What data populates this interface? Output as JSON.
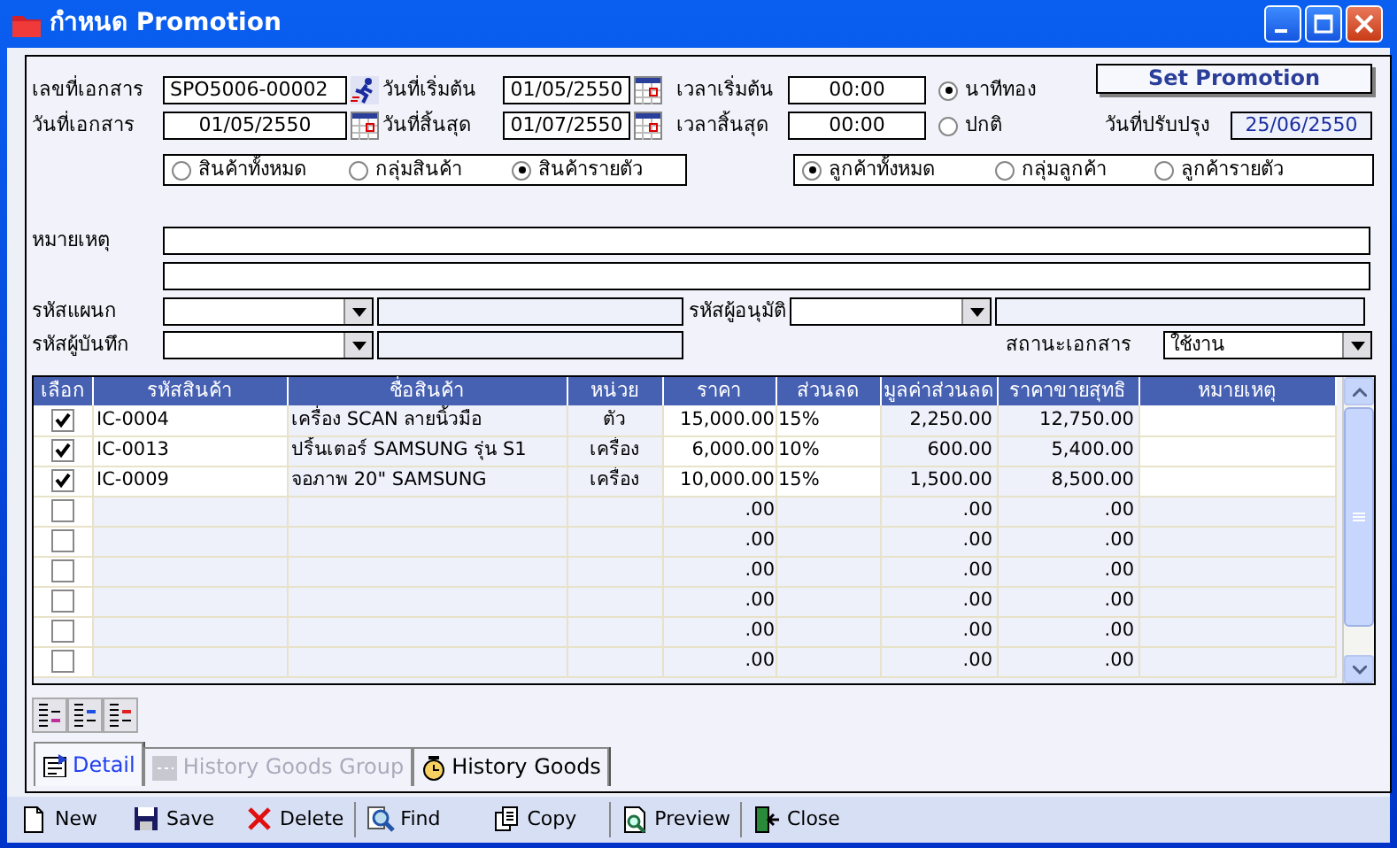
{
  "window": {
    "title": "กำหนด Promotion"
  },
  "header": {
    "document_no": {
      "label": "เลขที่เอกสาร",
      "value": "SPO5006-00002"
    },
    "start_date": {
      "label": "วันที่เริ่มต้น",
      "value": "01/05/2550"
    },
    "start_time": {
      "label": "เวลาเริ่มต้น",
      "value": "00:00"
    },
    "document_date": {
      "label": "วันที่เอกสาร",
      "value": "01/05/2550"
    },
    "end_date": {
      "label": "วันที่สิ้นสุด",
      "value": "01/07/2550"
    },
    "end_time": {
      "label": "เวลาสิ้นสุด",
      "value": "00:00"
    },
    "promotion_type": [
      {
        "label": "นาทีทอง",
        "selected": true
      },
      {
        "label": "ปกติ",
        "selected": false
      }
    ],
    "set_promotion_button": "Set Promotion",
    "updated_date": {
      "label": "วันที่ปรับปรุง",
      "value": "25/06/2550"
    },
    "product_scope": [
      {
        "label": "สินค้าทั้งหมด",
        "selected": false
      },
      {
        "label": "กลุ่มสินค้า",
        "selected": false
      },
      {
        "label": "สินค้ารายตัว",
        "selected": true
      }
    ],
    "customer_scope": [
      {
        "label": "ลูกค้าทั้งหมด",
        "selected": true
      },
      {
        "label": "กลุ่มลูกค้า",
        "selected": false
      },
      {
        "label": "ลูกค้ารายตัว",
        "selected": false
      }
    ],
    "remark": {
      "label": "หมายเหตุ"
    },
    "department": {
      "label": "รหัสแผนก"
    },
    "approver": {
      "label": "รหัสผู้อนุมัติ"
    },
    "recorder": {
      "label": "รหัสผู้บันทึก"
    },
    "document_status": {
      "label": "สถานะเอกสาร",
      "value": "ใช้งาน"
    }
  },
  "table": {
    "columns": [
      "เลือก",
      "รหัสสินค้า",
      "ชื่อสินค้า",
      "หน่วย",
      "ราคา",
      "ส่วนลด",
      "มูลค่าส่วนลด",
      "ราคาขายสุทธิ",
      "หมายเหตุ"
    ],
    "rows": [
      {
        "checked": true,
        "code": "IC-0004",
        "name": "เครื่อง SCAN ลายนิ้วมือ",
        "unit": "ตัว",
        "price": "15,000.00",
        "discount": "15%",
        "discount_value": "2,250.00",
        "net_price": "12,750.00"
      },
      {
        "checked": true,
        "code": "IC-0013",
        "name": "ปริ้นเตอร์ SAMSUNG รุ่น S1",
        "unit": "เครื่อง",
        "price": "6,000.00",
        "discount": "10%",
        "discount_value": "600.00",
        "net_price": "5,400.00"
      },
      {
        "checked": true,
        "code": "IC-0009",
        "name": "จอภาพ 20\" SAMSUNG",
        "unit": "เครื่อง",
        "price": "10,000.00",
        "discount": "15%",
        "discount_value": "1,500.00",
        "net_price": "8,500.00"
      },
      {
        "checked": false,
        "price": ".00",
        "discount_value": ".00",
        "net_price": ".00"
      },
      {
        "checked": false,
        "price": ".00",
        "discount_value": ".00",
        "net_price": ".00"
      },
      {
        "checked": false,
        "price": ".00",
        "discount_value": ".00",
        "net_price": ".00"
      },
      {
        "checked": false,
        "price": ".00",
        "discount_value": ".00",
        "net_price": ".00"
      },
      {
        "checked": false,
        "price": ".00",
        "discount_value": ".00",
        "net_price": ".00"
      },
      {
        "checked": false,
        "price": ".00",
        "discount_value": ".00",
        "net_price": ".00"
      }
    ]
  },
  "tabs": [
    {
      "label": "Detail",
      "selected": true,
      "disabled": false
    },
    {
      "label": "History Goods Group",
      "selected": false,
      "disabled": true
    },
    {
      "label": "History Goods",
      "selected": false,
      "disabled": false
    }
  ],
  "toolbar": [
    {
      "label": "New"
    },
    {
      "label": "Save"
    },
    {
      "label": "Delete"
    },
    {
      "label": "Find"
    },
    {
      "label": "Copy"
    },
    {
      "label": "Preview"
    },
    {
      "label": "Close"
    }
  ]
}
